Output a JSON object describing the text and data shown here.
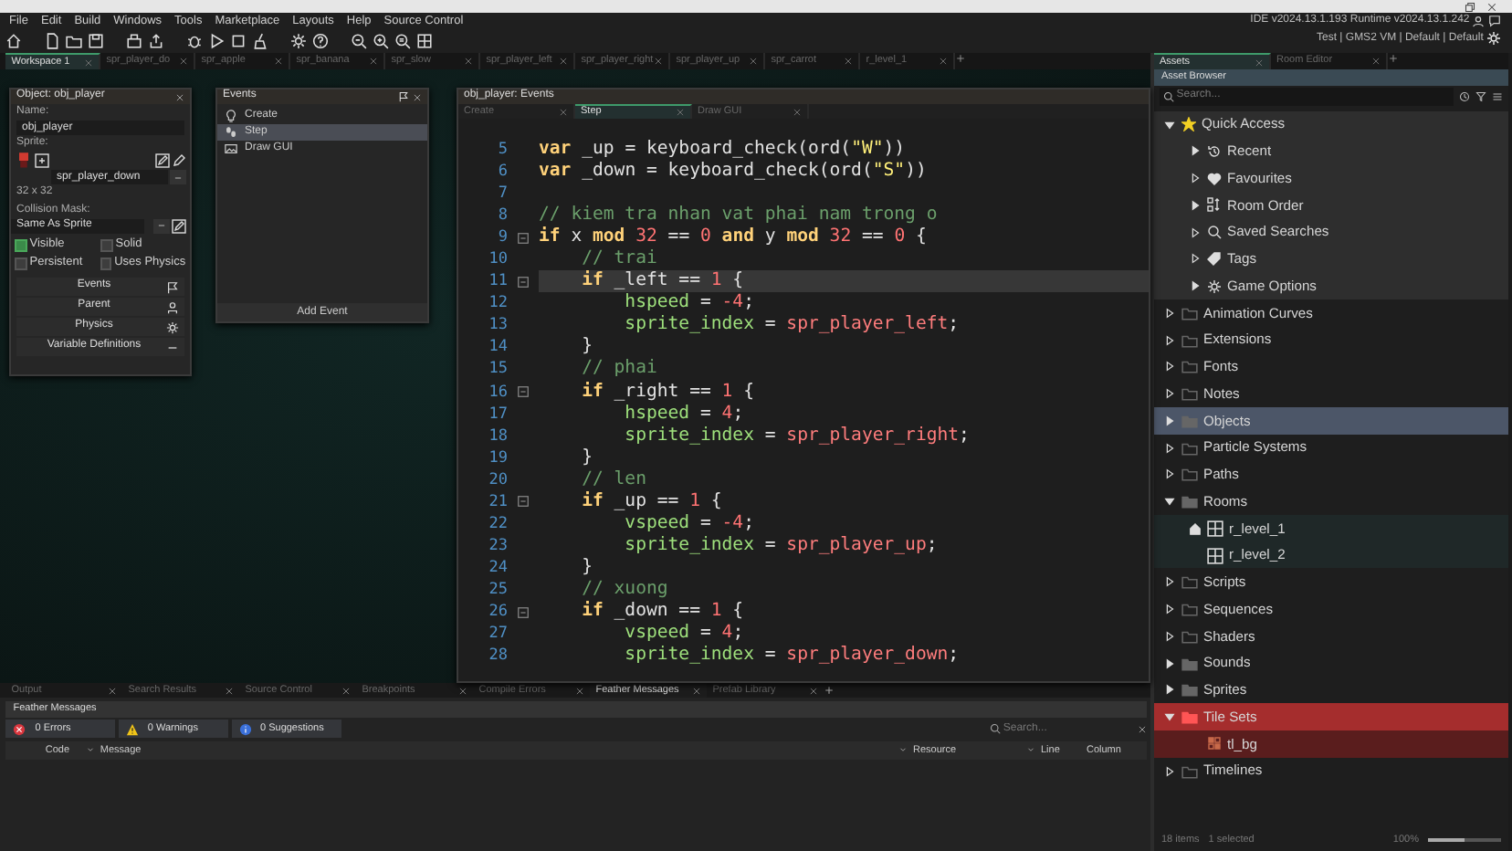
{
  "menu": [
    "File",
    "Edit",
    "Build",
    "Windows",
    "Tools",
    "Marketplace",
    "Layouts",
    "Help",
    "Source Control"
  ],
  "version": "IDE v2024.13.1.193  Runtime v2024.13.1.242",
  "target": "Test | GMS2 VM | Default | Default",
  "workspace_tabs": [
    {
      "label": "Workspace 1",
      "selected": true
    },
    {
      "label": "spr_player_do",
      "selected": false
    },
    {
      "label": "spr_apple",
      "selected": false
    },
    {
      "label": "spr_banana",
      "selected": false
    },
    {
      "label": "spr_slow",
      "selected": false
    },
    {
      "label": "spr_player_left",
      "selected": false
    },
    {
      "label": "spr_player_right",
      "selected": false
    },
    {
      "label": "spr_player_up",
      "selected": false
    },
    {
      "label": "spr_carrot",
      "selected": false
    },
    {
      "label": "r_level_1",
      "selected": false
    }
  ],
  "object_panel": {
    "title": "Object: obj_player",
    "name_label": "Name:",
    "name": "obj_player",
    "sprite_label": "Sprite:",
    "sprite": "spr_player_down",
    "sprite_size": "32 x 32",
    "collision_label": "Collision Mask:",
    "collision": "Same As Sprite",
    "checkboxes": [
      {
        "label": "Visible",
        "checked": true
      },
      {
        "label": "Solid",
        "checked": false
      },
      {
        "label": "Persistent",
        "checked": false
      },
      {
        "label": "Uses Physics",
        "checked": false
      }
    ],
    "buttons": [
      {
        "label": "Events",
        "kind": "events"
      },
      {
        "label": "Parent",
        "kind": "parent"
      },
      {
        "label": "Physics",
        "kind": "physics"
      },
      {
        "label": "Variable Definitions",
        "kind": "variables"
      }
    ]
  },
  "events_panel": {
    "title": "Events",
    "events": [
      {
        "label": "Create",
        "kind": "create",
        "selected": false
      },
      {
        "label": "Step",
        "kind": "step",
        "selected": true
      },
      {
        "label": "Draw GUI",
        "kind": "draw",
        "selected": false
      }
    ],
    "add_button": "Add Event"
  },
  "code_editor": {
    "title": "obj_player: Events",
    "tabs": [
      {
        "label": "Create",
        "selected": false
      },
      {
        "label": "Step",
        "selected": true
      },
      {
        "label": "Draw GUI",
        "selected": false
      }
    ],
    "lines": [
      {
        "number": "5",
        "fold": false,
        "highlighted": false,
        "segments": [
          {
            "kind": "keyword",
            "text": "var"
          },
          {
            "kind": "plain",
            "text": " _up = keyboard_check(ord("
          },
          {
            "kind": "string",
            "text": "\"W\""
          },
          {
            "kind": "plain",
            "text": "))"
          }
        ]
      },
      {
        "number": "6",
        "fold": false,
        "highlighted": false,
        "segments": [
          {
            "kind": "keyword",
            "text": "var"
          },
          {
            "kind": "plain",
            "text": " _down = keyboard_check(ord("
          },
          {
            "kind": "string",
            "text": "\"S\""
          },
          {
            "kind": "plain",
            "text": "))"
          }
        ]
      },
      {
        "number": "7",
        "fold": false,
        "highlighted": false
      },
      {
        "number": "8",
        "fold": false,
        "highlighted": false,
        "segments": [
          {
            "kind": "comment",
            "text": "// kiem tra nhan vat phai nam trong o"
          }
        ]
      },
      {
        "number": "9",
        "fold": true,
        "highlighted": false,
        "segments": [
          {
            "kind": "keyword",
            "text": "if"
          },
          {
            "kind": "plain",
            "text": " x "
          },
          {
            "kind": "keyword",
            "text": "mod"
          },
          {
            "kind": "number",
            "text": " 32"
          },
          {
            "kind": "plain",
            "text": " == "
          },
          {
            "kind": "number",
            "text": "0"
          },
          {
            "kind": "keyword",
            "text": " and"
          },
          {
            "kind": "plain",
            "text": " y "
          },
          {
            "kind": "keyword",
            "text": "mod"
          },
          {
            "kind": "number",
            "text": " 32"
          },
          {
            "kind": "plain",
            "text": " == "
          },
          {
            "kind": "number",
            "text": "0"
          },
          {
            "kind": "plain",
            "text": " {"
          }
        ]
      },
      {
        "number": "10",
        "fold": false,
        "highlighted": false,
        "segments": [
          {
            "kind": "comment",
            "text": "    // trai"
          }
        ]
      },
      {
        "number": "11",
        "fold": true,
        "highlighted": true,
        "segments": [
          {
            "kind": "keyword",
            "text": "    if"
          },
          {
            "kind": "plain",
            "text": " _left == "
          },
          {
            "kind": "number",
            "text": "1"
          },
          {
            "kind": "plain",
            "text": " {"
          }
        ]
      },
      {
        "number": "12",
        "fold": false,
        "highlighted": false,
        "segments": [
          {
            "kind": "builtin",
            "text": "        hspeed"
          },
          {
            "kind": "plain",
            "text": " = "
          },
          {
            "kind": "number",
            "text": "-4"
          },
          {
            "kind": "plain",
            "text": ";"
          }
        ]
      },
      {
        "number": "13",
        "fold": false,
        "highlighted": false,
        "segments": [
          {
            "kind": "builtin",
            "text": "        sprite_index"
          },
          {
            "kind": "plain",
            "text": " = "
          },
          {
            "kind": "resource",
            "text": "spr_player_left"
          },
          {
            "kind": "plain",
            "text": ";"
          }
        ]
      },
      {
        "number": "14",
        "fold": false,
        "highlighted": false,
        "segments": [
          {
            "kind": "plain",
            "text": "    }"
          }
        ]
      },
      {
        "number": "15",
        "fold": false,
        "highlighted": false,
        "segments": [
          {
            "kind": "comment",
            "text": "    // phai"
          }
        ]
      },
      {
        "number": "16",
        "fold": true,
        "highlighted": false,
        "segments": [
          {
            "kind": "keyword",
            "text": "    if"
          },
          {
            "kind": "plain",
            "text": " _right == "
          },
          {
            "kind": "number",
            "text": "1"
          },
          {
            "kind": "plain",
            "text": " {"
          }
        ]
      },
      {
        "number": "17",
        "fold": false,
        "highlighted": false,
        "segments": [
          {
            "kind": "builtin",
            "text": "        hspeed"
          },
          {
            "kind": "plain",
            "text": " = "
          },
          {
            "kind": "number",
            "text": "4"
          },
          {
            "kind": "plain",
            "text": ";"
          }
        ]
      },
      {
        "number": "18",
        "fold": false,
        "highlighted": false,
        "segments": [
          {
            "kind": "builtin",
            "text": "        sprite_index"
          },
          {
            "kind": "plain",
            "text": " = "
          },
          {
            "kind": "resource",
            "text": "spr_player_right"
          },
          {
            "kind": "plain",
            "text": ";"
          }
        ]
      },
      {
        "number": "19",
        "fold": false,
        "highlighted": false,
        "segments": [
          {
            "kind": "plain",
            "text": "    }"
          }
        ]
      },
      {
        "number": "20",
        "fold": false,
        "highlighted": false,
        "segments": [
          {
            "kind": "comment",
            "text": "    // len"
          }
        ]
      },
      {
        "number": "21",
        "fold": true,
        "highlighted": false,
        "segments": [
          {
            "kind": "keyword",
            "text": "    if"
          },
          {
            "kind": "plain",
            "text": " _up == "
          },
          {
            "kind": "number",
            "text": "1"
          },
          {
            "kind": "plain",
            "text": " {"
          }
        ]
      },
      {
        "number": "22",
        "fold": false,
        "highlighted": false,
        "segments": [
          {
            "kind": "builtin",
            "text": "        vspeed"
          },
          {
            "kind": "plain",
            "text": " = "
          },
          {
            "kind": "number",
            "text": "-4"
          },
          {
            "kind": "plain",
            "text": ";"
          }
        ]
      },
      {
        "number": "23",
        "fold": false,
        "highlighted": false,
        "segments": [
          {
            "kind": "builtin",
            "text": "        sprite_index"
          },
          {
            "kind": "plain",
            "text": " = "
          },
          {
            "kind": "resource",
            "text": "spr_player_up"
          },
          {
            "kind": "plain",
            "text": ";"
          }
        ]
      },
      {
        "number": "24",
        "fold": false,
        "highlighted": false,
        "segments": [
          {
            "kind": "plain",
            "text": "    }"
          }
        ]
      },
      {
        "number": "25",
        "fold": false,
        "highlighted": false,
        "segments": [
          {
            "kind": "comment",
            "text": "    // xuong"
          }
        ]
      },
      {
        "number": "26",
        "fold": true,
        "highlighted": false,
        "segments": [
          {
            "kind": "keyword",
            "text": "    if"
          },
          {
            "kind": "plain",
            "text": " _down == "
          },
          {
            "kind": "number",
            "text": "1"
          },
          {
            "kind": "plain",
            "text": " {"
          }
        ]
      },
      {
        "number": "27",
        "fold": false,
        "highlighted": false,
        "segments": [
          {
            "kind": "builtin",
            "text": "        vspeed"
          },
          {
            "kind": "plain",
            "text": " = "
          },
          {
            "kind": "number",
            "text": "4"
          },
          {
            "kind": "plain",
            "text": ";"
          }
        ]
      },
      {
        "number": "28",
        "fold": false,
        "highlighted": false,
        "segments": [
          {
            "kind": "builtin",
            "text": "        sprite_index"
          },
          {
            "kind": "plain",
            "text": " = "
          },
          {
            "kind": "resource",
            "text": "spr_player_down"
          },
          {
            "kind": "plain",
            "text": ";"
          }
        ]
      }
    ]
  },
  "output": {
    "tabs": [
      {
        "label": "Output",
        "selected": false
      },
      {
        "label": "Search Results",
        "selected": false
      },
      {
        "label": "Source Control",
        "selected": false
      },
      {
        "label": "Breakpoints",
        "selected": false
      },
      {
        "label": "Compile Errors",
        "selected": false
      },
      {
        "label": "Feather Messages",
        "selected": true
      },
      {
        "label": "Prefab Library",
        "selected": false
      }
    ],
    "title": "Feather Messages",
    "filters": [
      {
        "label": "0 Errors",
        "kind": "error"
      },
      {
        "label": "0 Warnings",
        "kind": "warning"
      },
      {
        "label": "0 Suggestions",
        "kind": "info"
      }
    ],
    "search": {
      "placeholder": "Search..."
    },
    "columns": [
      "Code",
      "Message",
      "Resource",
      "Line",
      "Column"
    ]
  },
  "dock_tabs": [
    {
      "label": "Assets",
      "selected": true
    },
    {
      "label": "Room Editor",
      "selected": false
    }
  ],
  "assets": {
    "title": "Asset Browser",
    "search": {
      "placeholder": "Search..."
    },
    "tree": [
      {
        "label": "Quick Access",
        "kind": "quick-access",
        "expanded": true,
        "empty": false,
        "selected": false,
        "hovered": false,
        "children": [
          {
            "label": "Recent",
            "kind": "recent",
            "empty": false,
            "selected": false
          },
          {
            "label": "Favourites",
            "kind": "favourites",
            "empty": true,
            "selected": false
          },
          {
            "label": "Room Order",
            "kind": "room-order",
            "empty": false,
            "selected": false
          },
          {
            "label": "Saved Searches",
            "kind": "saved-searches",
            "empty": true,
            "selected": false
          },
          {
            "label": "Tags",
            "kind": "tags",
            "empty": true,
            "selected": false
          },
          {
            "label": "Game Options",
            "kind": "game-options",
            "empty": false,
            "selected": false
          }
        ]
      },
      {
        "label": "Animation Curves",
        "kind": "folder",
        "expanded": false,
        "empty": true,
        "selected": false,
        "hovered": false
      },
      {
        "label": "Extensions",
        "kind": "folder",
        "expanded": false,
        "empty": true,
        "selected": false,
        "hovered": false
      },
      {
        "label": "Fonts",
        "kind": "folder",
        "expanded": false,
        "empty": true,
        "selected": false,
        "hovered": false
      },
      {
        "label": "Notes",
        "kind": "folder",
        "expanded": false,
        "empty": true,
        "selected": false,
        "hovered": false
      },
      {
        "label": "Objects",
        "kind": "folder",
        "expanded": false,
        "empty": false,
        "selected": false,
        "hovered": true
      },
      {
        "label": "Particle Systems",
        "kind": "folder",
        "expanded": false,
        "empty": true,
        "selected": false,
        "hovered": false
      },
      {
        "label": "Paths",
        "kind": "folder",
        "expanded": false,
        "empty": true,
        "selected": false,
        "hovered": false
      },
      {
        "label": "Rooms",
        "kind": "folder",
        "expanded": true,
        "empty": false,
        "selected": false,
        "hovered": false,
        "children": [
          {
            "label": "r_level_1",
            "kind": "room",
            "start": true,
            "selected": false
          },
          {
            "label": "r_level_2",
            "kind": "room",
            "start": false,
            "selected": false
          }
        ]
      },
      {
        "label": "Scripts",
        "kind": "folder",
        "expanded": false,
        "empty": true,
        "selected": false,
        "hovered": false
      },
      {
        "label": "Sequences",
        "kind": "folder",
        "expanded": false,
        "empty": true,
        "selected": false,
        "hovered": false
      },
      {
        "label": "Shaders",
        "kind": "folder",
        "expanded": false,
        "empty": true,
        "selected": false,
        "hovered": false
      },
      {
        "label": "Sounds",
        "kind": "folder",
        "expanded": false,
        "empty": false,
        "selected": false,
        "hovered": false
      },
      {
        "label": "Sprites",
        "kind": "folder",
        "expanded": false,
        "empty": false,
        "selected": false,
        "hovered": false
      },
      {
        "label": "Tile Sets",
        "kind": "folder",
        "expanded": true,
        "empty": false,
        "selected": true,
        "hovered": false,
        "children": [
          {
            "label": "tl_bg",
            "kind": "tileset",
            "selected": false
          }
        ]
      },
      {
        "label": "Timelines",
        "kind": "folder",
        "expanded": false,
        "empty": true,
        "selected": false,
        "hovered": false
      }
    ],
    "footer": {
      "items": "18 items",
      "selection": "1 selected",
      "zoom": "100%",
      "zoom_slider": {
        "level": 0.5
      }
    }
  }
}
